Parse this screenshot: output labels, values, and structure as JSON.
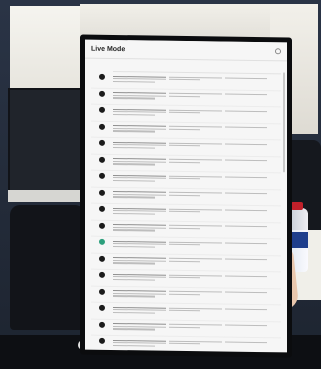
{
  "app": {
    "title": "Live Mode"
  },
  "rows": [
    {
      "avatar": "dark"
    },
    {
      "avatar": "dark"
    },
    {
      "avatar": "dark"
    },
    {
      "avatar": "dark"
    },
    {
      "avatar": "dark"
    },
    {
      "avatar": "dark"
    },
    {
      "avatar": "dark"
    },
    {
      "avatar": "dark"
    },
    {
      "avatar": "dark"
    },
    {
      "avatar": "dark"
    },
    {
      "avatar": "green"
    },
    {
      "avatar": "dark"
    },
    {
      "avatar": "dark"
    },
    {
      "avatar": "dark"
    },
    {
      "avatar": "dark"
    },
    {
      "avatar": "dark"
    },
    {
      "avatar": "dark"
    },
    {
      "avatar": "dark"
    }
  ],
  "colors": {
    "screen_bg": "#f6f6f6",
    "avatar_dark": "#1b1b1b",
    "avatar_green": "#2c9f7c"
  }
}
